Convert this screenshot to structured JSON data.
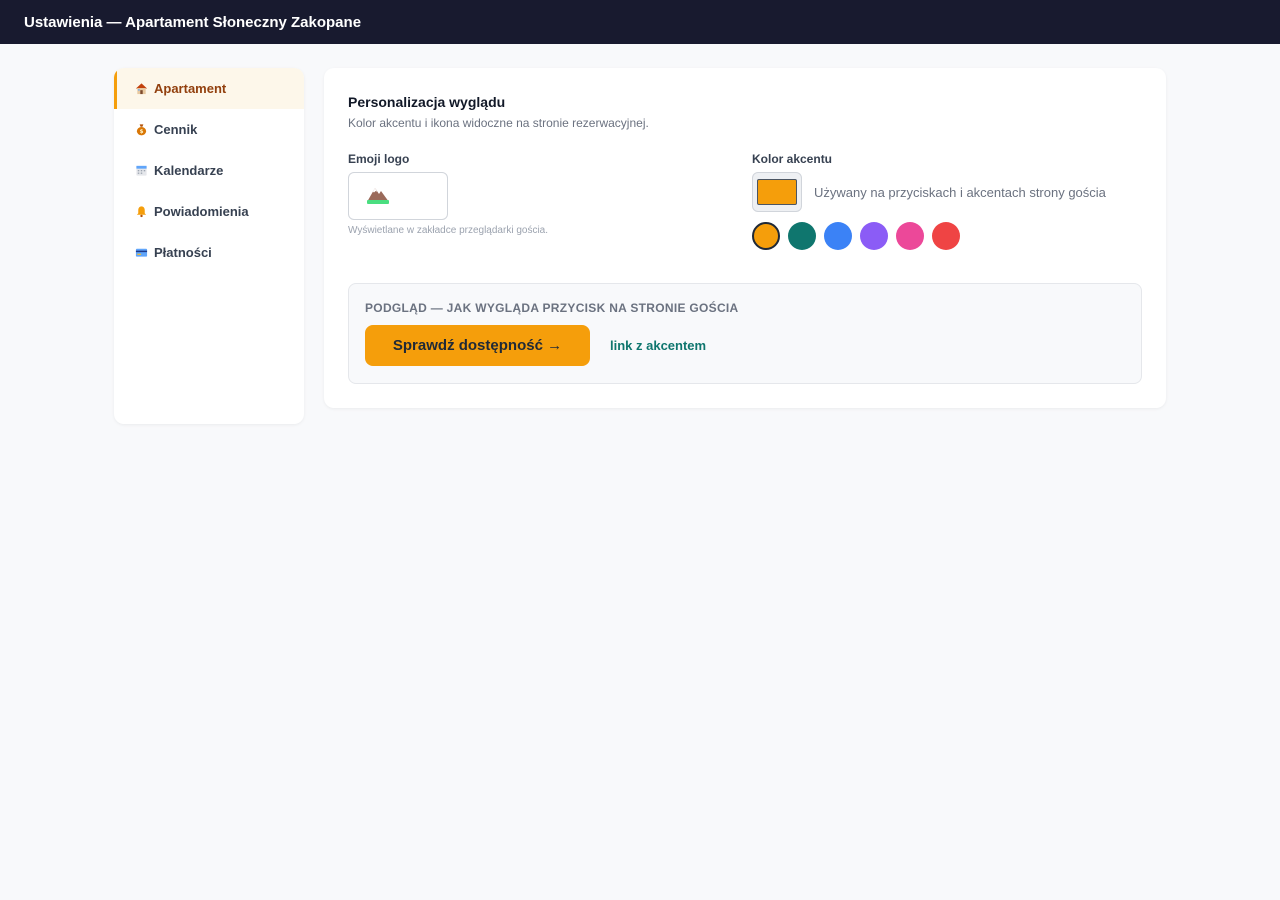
{
  "header": {
    "title": "Ustawienia — Apartament Słoneczny Zakopane"
  },
  "sidebar": {
    "items": [
      {
        "label": "Apartament",
        "icon": "house-icon",
        "active": true
      },
      {
        "label": "Cennik",
        "icon": "money-bag-icon",
        "active": false
      },
      {
        "label": "Kalendarze",
        "icon": "calendar-icon",
        "active": false
      },
      {
        "label": "Powiadomienia",
        "icon": "bell-icon",
        "active": false
      },
      {
        "label": "Płatności",
        "icon": "credit-card-icon",
        "active": false
      }
    ]
  },
  "card": {
    "title": "Personalizacja wyglądu",
    "subtitle": "Kolor akcentu i ikona widoczne na stronie rezerwacyjnej."
  },
  "emoji_field": {
    "label": "Emoji logo",
    "value": "⛰",
    "icon": "mountain-icon",
    "hint": "Wyświetlane w zakładce przeglądarki gościa."
  },
  "accent_field": {
    "label": "Kolor akcentu",
    "value": "#f59e0b",
    "description": "Używany na przyciskach i akcentach strony gościa",
    "swatches": [
      "#f59e0b",
      "#0f766e",
      "#3b82f6",
      "#8b5cf6",
      "#ec4899",
      "#ef4444"
    ],
    "selected_swatch": "#f59e0b"
  },
  "preview": {
    "title": "PODGLĄD — JAK WYGLĄDA PRZYCISK NA STRONIE GOŚCIA",
    "button_label": "Sprawdź dostępność →",
    "link_label": "link z akcentem"
  },
  "colors": {
    "topbar": "#181a2f",
    "accent": "#f59e0b",
    "link": "#0f766e"
  }
}
